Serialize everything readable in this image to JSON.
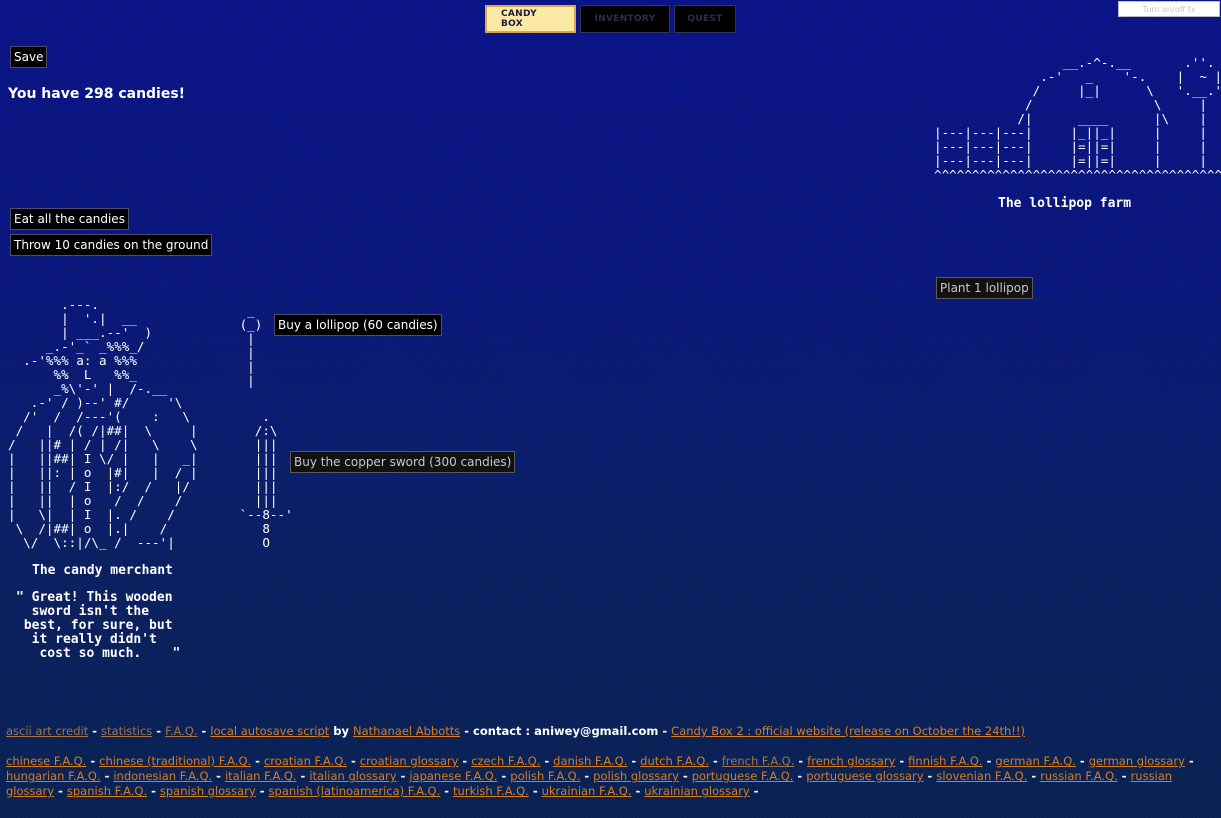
{
  "tabs": [
    {
      "label": "CANDY BOX",
      "active": true
    },
    {
      "label": "INVENTORY",
      "active": false
    },
    {
      "label": "QUEST",
      "active": false
    }
  ],
  "fx_toggle_label": "Turn on/off fx",
  "save_label": "Save",
  "candies_text": "You have 298 candies!",
  "eat_label": "Eat all the candies",
  "throw_label": "Throw 10 candies on the ground",
  "merchant": {
    "caption": "The candy merchant",
    "quote": "\" Great! This wooden\n  sword isn't the\n best, for sure, but\n  it really didn't\n   cost so much.    \"",
    "buy_lollipop_label": "Buy a lollipop (60 candies)",
    "buy_sword_label": "Buy the copper sword (300 candies)"
  },
  "farm": {
    "caption": "The lollipop farm",
    "plant_label": "Plant 1 lollipop"
  },
  "footer": {
    "line1": [
      {
        "text": "ascii art credit",
        "link": true,
        "dim": true
      },
      {
        "text": " - ",
        "link": false
      },
      {
        "text": "statistics",
        "link": true,
        "dim": true
      },
      {
        "text": " - ",
        "link": false
      },
      {
        "text": "F.A.Q.",
        "link": true,
        "dim": true
      },
      {
        "text": " - ",
        "link": false
      },
      {
        "text": "local autosave script",
        "link": true
      },
      {
        "text": " by ",
        "link": false
      },
      {
        "text": "Nathanael Abbotts",
        "link": true
      },
      {
        "text": " - contact : aniwey@gmail.com - ",
        "link": false
      },
      {
        "text": "Candy Box 2 : official website (release on October the 24th!!)",
        "link": true
      }
    ],
    "languages": [
      {
        "text": "chinese F.A.Q."
      },
      {
        "text": "chinese (traditional) F.A.Q."
      },
      {
        "text": "croatian F.A.Q."
      },
      {
        "text": "croatian glossary"
      },
      {
        "text": "czech F.A.Q."
      },
      {
        "text": "danish F.A.Q."
      },
      {
        "text": "dutch F.A.Q."
      },
      {
        "text": "french F.A.Q.",
        "dim": true
      },
      {
        "text": "french glossary"
      },
      {
        "text": "finnish F.A.Q."
      },
      {
        "text": "german F.A.Q."
      },
      {
        "text": "german glossary"
      },
      {
        "text": "hungarian F.A.Q."
      },
      {
        "text": "indonesian F.A.Q."
      },
      {
        "text": "italian F.A.Q."
      },
      {
        "text": "italian glossary"
      },
      {
        "text": "japanese F.A.Q."
      },
      {
        "text": "polish F.A.Q."
      },
      {
        "text": "polish glossary"
      },
      {
        "text": "portuguese F.A.Q."
      },
      {
        "text": "portuguese glossary"
      },
      {
        "text": "slovenian F.A.Q."
      },
      {
        "text": "russian F.A.Q."
      },
      {
        "text": "russian glossary"
      },
      {
        "text": "spanish F.A.Q."
      },
      {
        "text": "spanish glossary"
      },
      {
        "text": "spanish (latinoamerica) F.A.Q."
      },
      {
        "text": "turkish F.A.Q."
      },
      {
        "text": "ukrainian F.A.Q."
      },
      {
        "text": "ukrainian glossary"
      }
    ]
  }
}
